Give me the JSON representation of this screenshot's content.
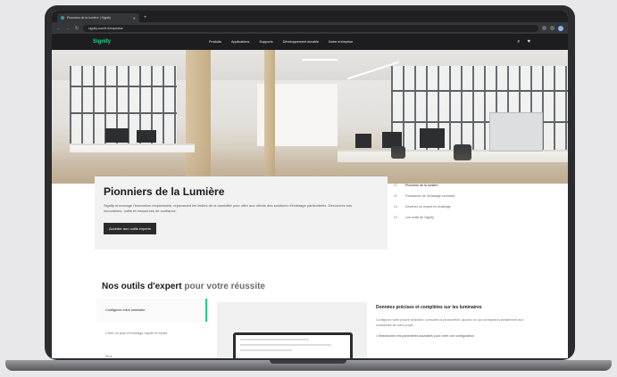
{
  "browser": {
    "tab_title": "Pionniers de la lumière | Signify",
    "new_tab": "+",
    "url": "signify.com/fr-fr/expertise"
  },
  "site": {
    "logo": "Signify",
    "nav": [
      "Produits",
      "Applications",
      "Supports",
      "Développement durable",
      "Notre entreprise"
    ]
  },
  "intro": {
    "title": "Pionniers de la Lumière",
    "text": "Signify encourage l'innovation responsable, repoussant les limites de la durabilité pour offrir aux clients des solutions d'éclairage particulières. Découvrez nos innovations, outils et ressources de confiance.",
    "button": "Accéder aux outils experts"
  },
  "toc": [
    {
      "num": "01",
      "label": "Pionniers de la lumière"
    },
    {
      "num": "02",
      "label": "Fondations de l'éclairage connecté"
    },
    {
      "num": "03",
      "label": "Devenez un expert en éclairage"
    },
    {
      "num": "04",
      "label": "Les outils de Signify"
    }
  ],
  "tools": {
    "title_main": "Nos outils d'expert ",
    "title_accent": "pour votre réussite",
    "nav": [
      "Configurez votre luminaire",
      "Créer un plan d'éclairage rapide et intuitif",
      "Plus"
    ],
    "copy_title": "Données précises et complètes sur les luminaires",
    "copy_text": "Configurez votre propre luminaire, consultez la photométrie, ajoutez ce qui correspond parfaitement aux contraintes de votre projet.",
    "copy_bullet": "• Sélectionnez les paramètres souhaités pour créer une configuration"
  },
  "colors": {
    "brand_green": "#1fd28b",
    "header_bg": "#1d1d1f"
  },
  "icons": [
    "search-icon",
    "heart-icon",
    "back-icon",
    "forward-icon",
    "reload-icon",
    "close-icon"
  ]
}
